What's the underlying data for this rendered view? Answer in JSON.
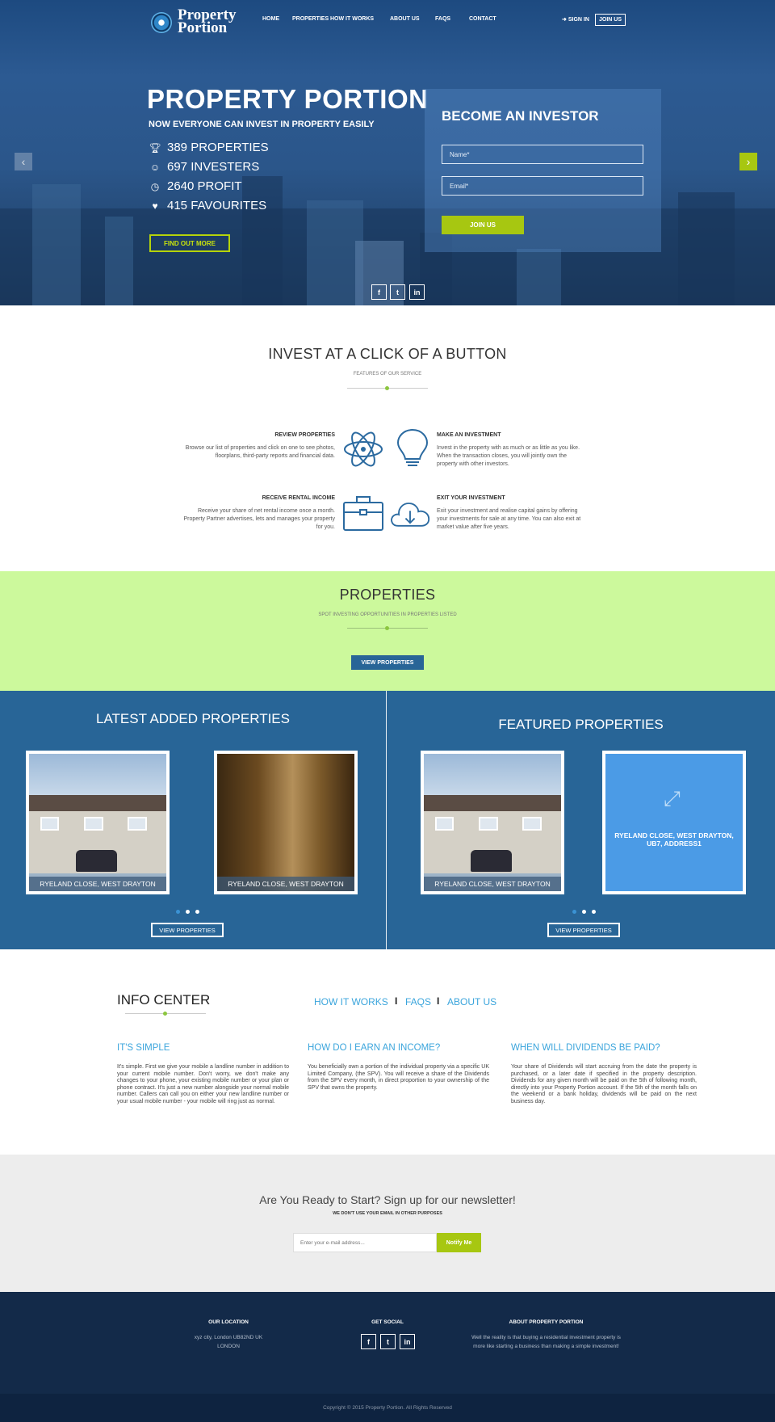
{
  "header": {
    "logo_text_line1": "Property",
    "logo_text_line2": "Portion",
    "nav": [
      "HOME",
      "PROPERTIES",
      "HOW IT WORKS",
      "ABOUT US",
      "FAQS",
      "CONTACT"
    ],
    "signin": "SIGN IN",
    "joinus": "JOIN US"
  },
  "hero": {
    "title": "PROPERTY PORTION",
    "subtitle": "NOW EVERYONE CAN INVEST IN PROPERTY EASILY",
    "stats": [
      {
        "icon": "trophy-icon",
        "text": "389 PROPERTIES"
      },
      {
        "icon": "smiley-icon",
        "text": "697 INVESTERS"
      },
      {
        "icon": "clock-icon",
        "text": "2640 PROFIT"
      },
      {
        "icon": "heart-icon",
        "text": "415 FAVOURITES"
      }
    ],
    "cta": "FIND OUT MORE",
    "investor_title": "BECOME AN INVESTOR",
    "name_placeholder": "Name*",
    "email_placeholder": "Email*",
    "join_button": "JOIN US",
    "social": [
      "f",
      "t",
      "in"
    ]
  },
  "invest": {
    "title": "INVEST AT A CLICK OF A BUTTON",
    "subtitle": "FEATURES OF OUR SERVICE",
    "features": [
      {
        "title": "REVIEW PROPERTIES",
        "text": "Browse our list of properties and click on one to see photos, floorplans, third-party reports and financial data.",
        "icon": "atom-icon"
      },
      {
        "title": "MAKE AN INVESTMENT",
        "text": "Invest in the property with as much or as little as you like. When the transaction closes, you will jointly own the property with other investors.",
        "icon": "lightbulb-icon"
      },
      {
        "title": "RECEIVE RENTAL INCOME",
        "text": "Receive your share of net rental income once a month. Property Partner advertises, lets and manages your property for you.",
        "icon": "briefcase-icon"
      },
      {
        "title": "EXIT YOUR INVESTMENT",
        "text": "Exit your investment and realise capital gains by offering your investments for sale at any time. You can also exit at market value after five years.",
        "icon": "cloud-download-icon"
      }
    ]
  },
  "properties": {
    "title": "PROPERTIES",
    "subtitle": "SPOT INVESTING OPPORTUNITIES IN PROPERTIES LISTED",
    "button": "VIEW PROPERTIES"
  },
  "latest": {
    "title": "LATEST ADDED PROPERTIES",
    "cards": [
      "RYELAND CLOSE, WEST DRAYTON",
      "RYELAND CLOSE, WEST DRAYTON"
    ],
    "button": "VIEW PROPERTIES"
  },
  "featured": {
    "title": "FEATURED PROPERTIES",
    "cards": [
      "RYELAND CLOSE, WEST DRAYTON",
      "RYELAND CLOSE, WEST DRAYTON, UB7, ADDRESS1"
    ],
    "button": "VIEW PROPERTIES"
  },
  "info": {
    "title": "INFO CENTER",
    "links": [
      "HOW IT WORKS",
      "FAQS",
      "ABOUT US"
    ],
    "separator": "I",
    "items": [
      {
        "q": "IT'S SIMPLE",
        "a": "It's simple. First we give your mobile a landline number in addition to your current mobile number. Don't worry, we don't make any changes to your phone, your existing mobile number or your plan or phone contract. It's just a new number alongside your normal mobile number. Callers can call you on either your new landline number or your usual mobile number - your mobile will ring just as normal."
      },
      {
        "q": "HOW DO I EARN AN INCOME?",
        "a": "You beneficially own a portion of the individual property via a specific UK Limited Company, (the SPV). You will receive a share of the Dividends from the SPV every month, in direct proportion to your ownership of the SPV that owns the property."
      },
      {
        "q": "WHEN WILL DIVIDENDS BE PAID?",
        "a": "Your share of Dividends will start accruing from the date the property is purchased, or a later date if specified in the property description. Dividends for any given month will be paid on the 5th of following month, directly into your Property Portion account. If the 5th of the month falls on the weekend or a bank holiday, dividends will be paid on the next business day."
      }
    ]
  },
  "newsletter": {
    "title": "Are You Ready to Start? Sign up for our newsletter!",
    "subtitle": "WE DON'T USE YOUR EMAIL IN OTHER PURPOSES",
    "placeholder": "Enter your e-mail address...",
    "button": "Notify Me"
  },
  "footer": {
    "location_title": "OUR LOCATION",
    "location_line1": "xyz city, London UB82ND UK",
    "location_line2": "LONDON",
    "social_title": "GET SOCIAL",
    "about_title": "ABOUT PROPERTY PORTION",
    "about_text": "Well the reality is that buying a residential investment property is more like starting a business than making a simple investment!",
    "copyright": "Copyright © 2015 Property Portion. All Rights Reserved"
  },
  "colors": {
    "navy": "#286597",
    "lime": "#a7c711",
    "light_green": "#ccf99c",
    "link_blue": "#3ba5dc",
    "footer": "#132a49"
  }
}
